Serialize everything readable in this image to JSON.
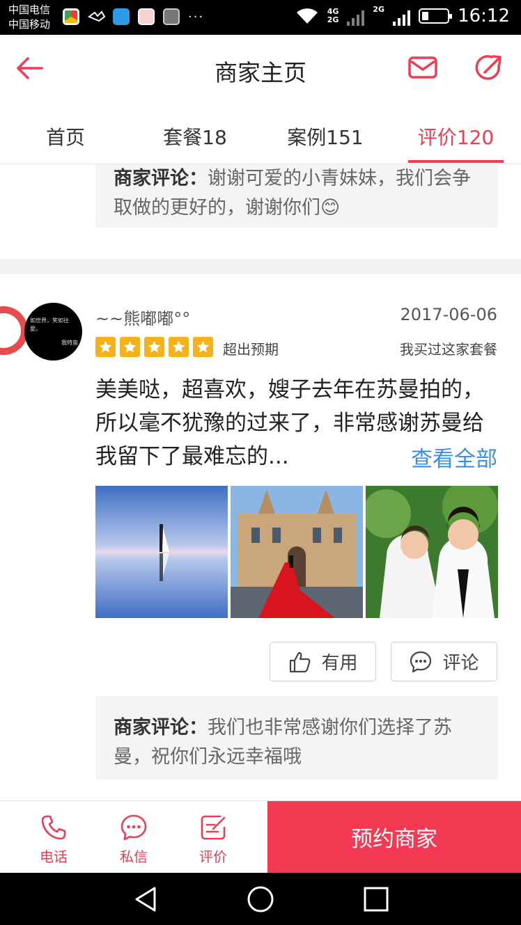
{
  "status_bar": {
    "carrier1": "中国电信",
    "carrier2": "中国移动",
    "net1": "4G",
    "net2": "2G",
    "net3": "2G",
    "more": "···",
    "time": "16:12"
  },
  "header": {
    "title": "商家主页"
  },
  "tabs": [
    {
      "label": "首页"
    },
    {
      "label": "套餐18"
    },
    {
      "label": "案例151"
    },
    {
      "label": "评价120"
    }
  ],
  "active_tab": "评价120",
  "prev_reply": {
    "prefix": "商家评论：",
    "text": "谢谢可爱的小青妹妹，我们会争取做的更好的，谢谢你们😊"
  },
  "review": {
    "avatar_text": "如世界，笑如往愛。",
    "avatar_sign": "我特蛮",
    "username": "~~熊嘟嘟°°",
    "date": "2017-06-06",
    "stars": 5,
    "rating_text": "超出预期",
    "bought_text": "我买过这家套餐",
    "content": "美美哒，超喜欢，嫂子去年在苏曼拍的，所以毫不犹豫的过来了，非常感谢苏曼给我留下了最难忘的...",
    "see_all": "查看全部",
    "useful_label": "有用",
    "comment_label": "评论",
    "reply_prefix": "商家评论：",
    "reply_text": "我们也非常感谢你们选择了苏曼，祝你们永远幸福哦"
  },
  "bottom_bar": {
    "phone": "电话",
    "message": "私信",
    "rate": "评价",
    "book": "预约商家"
  },
  "colors": {
    "accent": "#ef3b54",
    "book_button": "#f43a53",
    "link": "#3a8ee6",
    "star": "#f7b21b"
  }
}
